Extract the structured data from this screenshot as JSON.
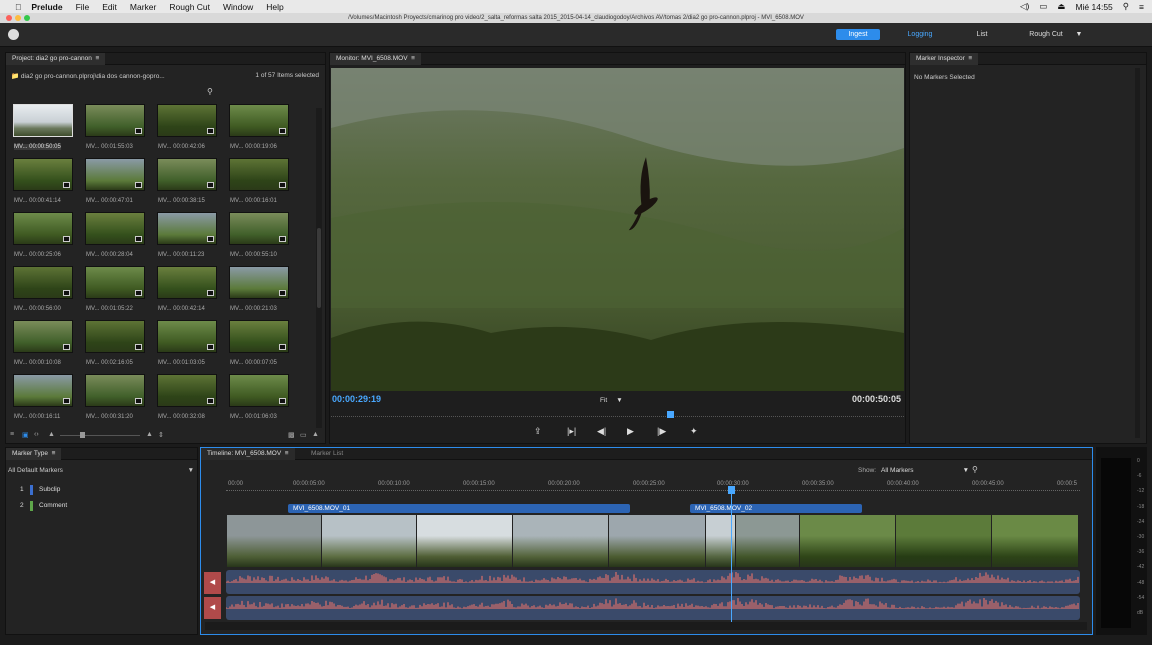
{
  "menubar": {
    "app": "Prelude",
    "items": [
      "File",
      "Edit",
      "Marker",
      "Rough Cut",
      "Window",
      "Help"
    ],
    "clock": "Mié 14:55"
  },
  "titlebar": {
    "path": "/Volumes/Macintosh Proyects/cmarinog pro video/2_salta_reformas salta 2015_2015-04-14_claudiogodoy/Archivos AV/tomas 2/dia2 go pro-cannon.plproj - MVI_6508.MOV"
  },
  "workspaces": {
    "ingest": "Ingest",
    "logging": "Logging",
    "list": "List",
    "roughcut": "Rough Cut"
  },
  "project": {
    "tab": "Project: dia2 go pro-cannon",
    "path": "dia2 go pro-cannon.plproj\\dia dos cannon-gopro...",
    "count": "1 of 57 Items selected",
    "thumbs": [
      "MV... 00:00:50:05",
      "MV... 00:01:55:03",
      "MV... 00:00:42:06",
      "MV... 00:00:19:06",
      "MV... 00:00:41:14",
      "MV... 00:00:47:01",
      "MV... 00:00:38:15",
      "MV... 00:00:16:01",
      "MV... 00:00:25:06",
      "MV... 00:00:28:04",
      "MV... 00:00:11:23",
      "MV... 00:00:55:10",
      "MV... 00:00:56:00",
      "MV... 00:01:05:22",
      "MV... 00:00:42:14",
      "MV... 00:00:21:03",
      "MV... 00:00:10:08",
      "MV... 00:02:16:05",
      "MV... 00:01:03:05",
      "MV... 00:00:07:05",
      "MV... 00:00:16:11",
      "MV... 00:00:31:20",
      "MV... 00:00:32:08",
      "MV... 00:01:06:03"
    ]
  },
  "monitor": {
    "tab": "Monitor: MVI_6508.MOV",
    "current": "00:00:29:19",
    "duration": "00:00:50:05",
    "zoom": "Fit"
  },
  "inspector": {
    "tab": "Marker Inspector",
    "empty": "No Markers Selected"
  },
  "markertype": {
    "tab": "Marker Type",
    "filter": "All Default Markers",
    "items": [
      {
        "num": "1",
        "label": "Subclip",
        "color": "#3b6fd0"
      },
      {
        "num": "2",
        "label": "Comment",
        "color": "#5ea64a"
      }
    ]
  },
  "timeline": {
    "tab": "Timeline: MVI_6508.MOV",
    "tab2": "Marker List",
    "show_label": "Show:",
    "show_value": "All Markers",
    "ruler": [
      "00:00",
      "00:00:05:00",
      "00:00:10:00",
      "00:00:15:00",
      "00:00:20:00",
      "00:00:25:00",
      "00:00:30:00",
      "00:00:35:00",
      "00:00:40:00",
      "00:00:45:00",
      "00:00:5"
    ],
    "subclips": [
      "MVI_6508.MOV_01",
      "MVI_6508.MOV_02"
    ]
  },
  "meter": {
    "labels": [
      "0",
      "-6",
      "-12",
      "-18",
      "-24",
      "-30",
      "-36",
      "-42",
      "-48",
      "-54",
      "dB"
    ]
  },
  "colors": {
    "accent": "#2d8ceb",
    "timecode": "#49a8ff",
    "subclip": "#2c64b4"
  }
}
